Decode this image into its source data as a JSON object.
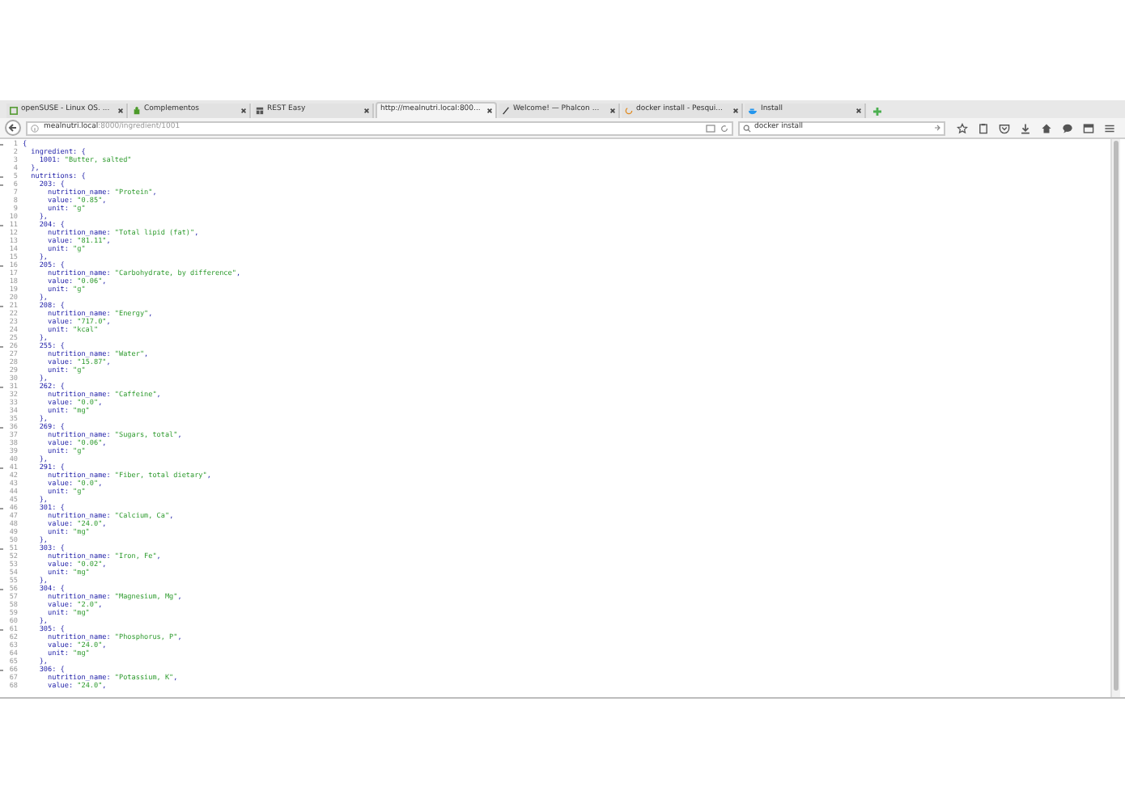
{
  "tabs": [
    {
      "title": "openSUSE - Linux OS. ...",
      "selected": false
    },
    {
      "title": "Complementos",
      "selected": false
    },
    {
      "title": "REST Easy",
      "selected": false
    },
    {
      "title": "http://mealnutri.local:800...",
      "selected": true
    },
    {
      "title": "Welcome! — Phalcon ...",
      "selected": false
    },
    {
      "title": "docker install - Pesqui...",
      "selected": false
    },
    {
      "title": "Install",
      "selected": false
    }
  ],
  "address_bar": {
    "host": "mealnutri.local",
    "path": ":8000/ingredient/1001"
  },
  "search_field": {
    "value": "docker install"
  },
  "code_lines": [
    {
      "number": "1",
      "text": "{",
      "fold": true
    },
    {
      "number": "2",
      "text": "  ingredient: {",
      "fold": false
    },
    {
      "number": "3",
      "text": "    1001: \"Butter, salted\"",
      "fold": false
    },
    {
      "number": "4",
      "text": "  },",
      "fold": false
    },
    {
      "number": "5",
      "text": "  nutritions: {",
      "fold": true
    },
    {
      "number": "6",
      "text": "    203: {",
      "fold": true
    },
    {
      "number": "7",
      "text": "      nutrition_name: \"Protein\",",
      "fold": false
    },
    {
      "number": "8",
      "text": "      value: \"0.85\",",
      "fold": false
    },
    {
      "number": "9",
      "text": "      unit: \"g\"",
      "fold": false
    },
    {
      "number": "10",
      "text": "    },",
      "fold": false
    },
    {
      "number": "11",
      "text": "    204: {",
      "fold": true
    },
    {
      "number": "12",
      "text": "      nutrition_name: \"Total lipid (fat)\",",
      "fold": false
    },
    {
      "number": "13",
      "text": "      value: \"81.11\",",
      "fold": false
    },
    {
      "number": "14",
      "text": "      unit: \"g\"",
      "fold": false
    },
    {
      "number": "15",
      "text": "    },",
      "fold": false
    },
    {
      "number": "16",
      "text": "    205: {",
      "fold": true
    },
    {
      "number": "17",
      "text": "      nutrition_name: \"Carbohydrate, by difference\",",
      "fold": false
    },
    {
      "number": "18",
      "text": "      value: \"0.06\",",
      "fold": false
    },
    {
      "number": "19",
      "text": "      unit: \"g\"",
      "fold": false
    },
    {
      "number": "20",
      "text": "    },",
      "fold": false
    },
    {
      "number": "21",
      "text": "    208: {",
      "fold": true
    },
    {
      "number": "22",
      "text": "      nutrition_name: \"Energy\",",
      "fold": false
    },
    {
      "number": "23",
      "text": "      value: \"717.0\",",
      "fold": false
    },
    {
      "number": "24",
      "text": "      unit: \"kcal\"",
      "fold": false
    },
    {
      "number": "25",
      "text": "    },",
      "fold": false
    },
    {
      "number": "26",
      "text": "    255: {",
      "fold": true
    },
    {
      "number": "27",
      "text": "      nutrition_name: \"Water\",",
      "fold": false
    },
    {
      "number": "28",
      "text": "      value: \"15.87\",",
      "fold": false
    },
    {
      "number": "29",
      "text": "      unit: \"g\"",
      "fold": false
    },
    {
      "number": "30",
      "text": "    },",
      "fold": false
    },
    {
      "number": "31",
      "text": "    262: {",
      "fold": true
    },
    {
      "number": "32",
      "text": "      nutrition_name: \"Caffeine\",",
      "fold": false
    },
    {
      "number": "33",
      "text": "      value: \"0.0\",",
      "fold": false
    },
    {
      "number": "34",
      "text": "      unit: \"mg\"",
      "fold": false
    },
    {
      "number": "35",
      "text": "    },",
      "fold": false
    },
    {
      "number": "36",
      "text": "    269: {",
      "fold": true
    },
    {
      "number": "37",
      "text": "      nutrition_name: \"Sugars, total\",",
      "fold": false
    },
    {
      "number": "38",
      "text": "      value: \"0.06\",",
      "fold": false
    },
    {
      "number": "39",
      "text": "      unit: \"g\"",
      "fold": false
    },
    {
      "number": "40",
      "text": "    },",
      "fold": false
    },
    {
      "number": "41",
      "text": "    291: {",
      "fold": true
    },
    {
      "number": "42",
      "text": "      nutrition_name: \"Fiber, total dietary\",",
      "fold": false
    },
    {
      "number": "43",
      "text": "      value: \"0.0\",",
      "fold": false
    },
    {
      "number": "44",
      "text": "      unit: \"g\"",
      "fold": false
    },
    {
      "number": "45",
      "text": "    },",
      "fold": false
    },
    {
      "number": "46",
      "text": "    301: {",
      "fold": true
    },
    {
      "number": "47",
      "text": "      nutrition_name: \"Calcium, Ca\",",
      "fold": false
    },
    {
      "number": "48",
      "text": "      value: \"24.0\",",
      "fold": false
    },
    {
      "number": "49",
      "text": "      unit: \"mg\"",
      "fold": false
    },
    {
      "number": "50",
      "text": "    },",
      "fold": false
    },
    {
      "number": "51",
      "text": "    303: {",
      "fold": true
    },
    {
      "number": "52",
      "text": "      nutrition_name: \"Iron, Fe\",",
      "fold": false
    },
    {
      "number": "53",
      "text": "      value: \"0.02\",",
      "fold": false
    },
    {
      "number": "54",
      "text": "      unit: \"mg\"",
      "fold": false
    },
    {
      "number": "55",
      "text": "    },",
      "fold": false
    },
    {
      "number": "56",
      "text": "    304: {",
      "fold": true
    },
    {
      "number": "57",
      "text": "      nutrition_name: \"Magnesium, Mg\",",
      "fold": false
    },
    {
      "number": "58",
      "text": "      value: \"2.0\",",
      "fold": false
    },
    {
      "number": "59",
      "text": "      unit: \"mg\"",
      "fold": false
    },
    {
      "number": "60",
      "text": "    },",
      "fold": false
    },
    {
      "number": "61",
      "text": "    305: {",
      "fold": true
    },
    {
      "number": "62",
      "text": "      nutrition_name: \"Phosphorus, P\",",
      "fold": false
    },
    {
      "number": "63",
      "text": "      value: \"24.0\",",
      "fold": false
    },
    {
      "number": "64",
      "text": "      unit: \"mg\"",
      "fold": false
    },
    {
      "number": "65",
      "text": "    },",
      "fold": false
    },
    {
      "number": "66",
      "text": "    306: {",
      "fold": true
    },
    {
      "number": "67",
      "text": "      nutrition_name: \"Potassium, K\",",
      "fold": false
    },
    {
      "number": "68",
      "text": "      value: \"24.0\",",
      "fold": false
    }
  ]
}
